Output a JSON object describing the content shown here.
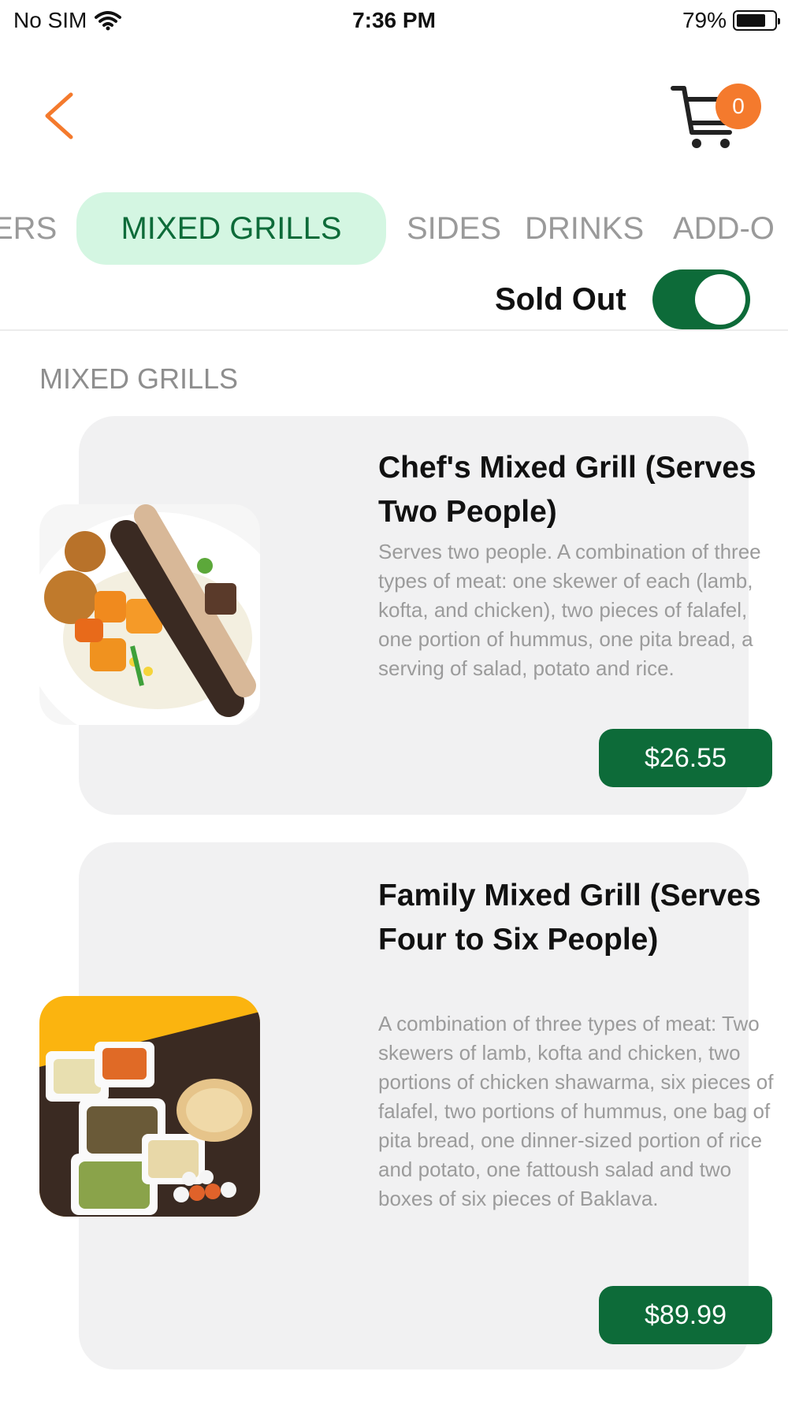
{
  "status_bar": {
    "carrier": "No SIM",
    "time": "7:36 PM",
    "battery": "79%",
    "battery_level": 0.79
  },
  "header": {
    "back_icon": "chevron-left-icon",
    "cart_icon": "cart-icon",
    "cart_count": "0"
  },
  "tabs": [
    {
      "label": "ERS"
    },
    {
      "label": "MIXED GRILLS",
      "active": true
    },
    {
      "label": "SIDES"
    },
    {
      "label": "DRINKS"
    },
    {
      "label": "ADD-O"
    }
  ],
  "sold_out": {
    "label": "Sold Out",
    "enabled": true
  },
  "section": {
    "title": "MIXED GRILLS"
  },
  "items": [
    {
      "title": "Chef's Mixed Grill (Serves Two People)",
      "description": "Serves two people. A combination of three types of meat: one skewer of each (lamb, kofta, and chicken), two pieces of falafel, one portion of hummus, one pita bread, a serving of salad, potato and rice.",
      "price": "$26.55"
    },
    {
      "title": "Family Mixed Grill (Serves Four to Six People)",
      "description": "A combination of three types of meat: Two skewers of lamb, kofta and chicken, two portions of chicken shawarma, six pieces of falafel, two portions of hummus, one bag of pita bread, one dinner-sized portion of rice and potato, one fattoush salad and two boxes of six pieces of Baklava.",
      "price": "$89.99"
    }
  ],
  "colors": {
    "accent_green": "#0d6b39",
    "active_tab_bg": "#d4f6e2",
    "badge_orange": "#f47a2d",
    "card_bg": "#f1f1f2"
  }
}
